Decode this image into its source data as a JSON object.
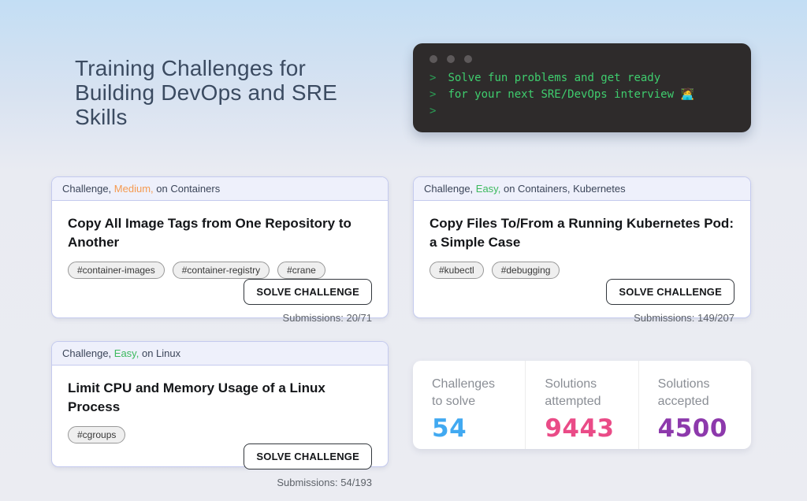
{
  "page": {
    "background_top_color": "#c3def4",
    "background_bottom_color": "#ebecf2"
  },
  "hero": {
    "title": "Training Challenges for Building DevOps and SRE Skills"
  },
  "terminal": {
    "background": "#2e2b2b",
    "prompt_color": "#2b9e55",
    "text_color": "#3fcd6e",
    "lines": [
      {
        "prompt": ">",
        "text": "Solve fun problems and get ready"
      },
      {
        "prompt": ">",
        "text": "for your next SRE/DevOps interview 🧑‍💻"
      },
      {
        "prompt": ">",
        "text": ""
      }
    ]
  },
  "cards": [
    {
      "header": {
        "kind": "Challenge,",
        "difficulty": "Medium,",
        "difficulty_style": "color: #f59a50",
        "topics": "on Containers"
      },
      "title": "Copy All Image Tags from One Repository to Another",
      "tags": [
        "#container-images",
        "#container-registry",
        "#crane"
      ],
      "button_label": "SOLVE CHALLENGE",
      "submissions": "Submissions: 20/71"
    },
    {
      "header": {
        "kind": "Challenge,",
        "difficulty": "Easy,",
        "difficulty_style": "color: #3cb95e",
        "topics": "on Containers, Kubernetes"
      },
      "title": "Copy Files To/From a Running Kubernetes Pod: a Simple Case",
      "tags": [
        "#kubectl",
        "#debugging"
      ],
      "button_label": "SOLVE CHALLENGE",
      "submissions": "Submissions: 149/207"
    },
    {
      "header": {
        "kind": "Challenge,",
        "difficulty": "Easy,",
        "difficulty_style": "color: #3cb95e",
        "topics": "on Linux"
      },
      "title": "Limit CPU and Memory Usage of a Linux Process",
      "tags": [
        "#cgroups"
      ],
      "button_label": "SOLVE CHALLENGE",
      "submissions": "Submissions: 54/193"
    }
  ],
  "stats": {
    "items": [
      {
        "label_line1": "Challenges",
        "label_line2": "to solve",
        "value": "54",
        "value_style": "color: #41a9f1"
      },
      {
        "label_line1": "Solutions",
        "label_line2": "attempted",
        "value": "9443",
        "value_style": "color: #ea4b87"
      },
      {
        "label_line1": "Solutions",
        "label_line2": "accepted",
        "value": "4500",
        "value_style": "color: #8d39ac"
      }
    ]
  }
}
